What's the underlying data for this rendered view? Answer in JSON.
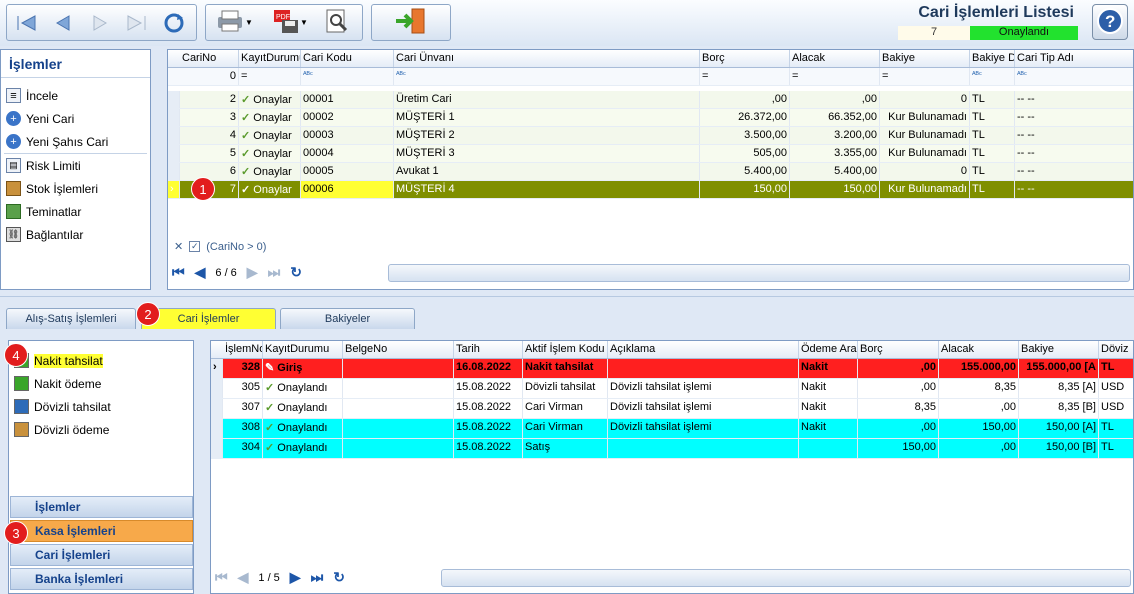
{
  "window": {
    "title": "Cari İşlemleri Listesi",
    "record_value": "7",
    "status": "Onaylandı",
    "status_color": "#22e22e"
  },
  "toolbar": {
    "icons": [
      "first-icon",
      "prev-icon",
      "next-icon",
      "last-icon",
      "refresh-icon",
      "print-icon",
      "pdf-save-icon",
      "search-doc-icon",
      "exit-icon",
      "help-icon"
    ]
  },
  "side_menu": {
    "title": "İşlemler",
    "items": [
      {
        "label": "İncele",
        "icon": "document-icon"
      },
      {
        "label": "Yeni Cari",
        "icon": "add-icon"
      },
      {
        "label": "Yeni Şahıs Cari",
        "icon": "add-icon"
      },
      {
        "label": "Risk Limiti",
        "icon": "chart-icon"
      },
      {
        "label": "Stok İşlemleri",
        "icon": "box-icon"
      },
      {
        "label": "Teminatlar",
        "icon": "money-icon"
      },
      {
        "label": "Bağlantılar",
        "icon": "link-icon"
      }
    ]
  },
  "top_grid": {
    "columns": [
      "CariNo",
      "KayıtDurumu",
      "Cari Kodu",
      "Cari Ünvanı",
      "Borç",
      "Alacak",
      "Bakiye",
      "Bakiye D",
      "Cari Tip Adı"
    ],
    "filter_row": {
      "cari_no": "0",
      "filter_symbol": "="
    },
    "rows": [
      {
        "no": "2",
        "status": "Onaylar",
        "code": "00001",
        "name": "Üretim Cari",
        "borc": ",00",
        "alacak": ",00",
        "bakiye": "0",
        "dov": "TL",
        "tip": "-- --"
      },
      {
        "no": "3",
        "status": "Onaylar",
        "code": "00002",
        "name": "MÜŞTERİ 1",
        "borc": "26.372,00",
        "alacak": "66.352,00",
        "bakiye": "Kur Bulunamadı",
        "dov": "TL",
        "tip": "-- --"
      },
      {
        "no": "4",
        "status": "Onaylar",
        "code": "00003",
        "name": "MÜŞTERİ 2",
        "borc": "3.500,00",
        "alacak": "3.200,00",
        "bakiye": "Kur Bulunamadı",
        "dov": "TL",
        "tip": "-- --"
      },
      {
        "no": "5",
        "status": "Onaylar",
        "code": "00004",
        "name": "MÜŞTERİ 3",
        "borc": "505,00",
        "alacak": "3.355,00",
        "bakiye": "Kur Bulunamadı",
        "dov": "TL",
        "tip": "-- --"
      },
      {
        "no": "6",
        "status": "Onaylar",
        "code": "00005",
        "name": "Avukat 1",
        "borc": "5.400,00",
        "alacak": "5.400,00",
        "bakiye": "0",
        "dov": "TL",
        "tip": "-- --"
      },
      {
        "no": "7",
        "status": "Onaylar",
        "code": "00006",
        "name": "MÜŞTERİ 4",
        "borc": "150,00",
        "alacak": "150,00",
        "bakiye": "Kur Bulunamadı",
        "dov": "TL",
        "tip": "-- --"
      }
    ],
    "filter_text": "(CariNo > 0)",
    "pager": "6 / 6"
  },
  "tabs": [
    "Alış-Satış İşlemleri",
    "Cari İşlemler",
    "Bakiyeler"
  ],
  "left_actions": [
    {
      "label": "Nakit tahsilat",
      "icon": "cash-in-icon"
    },
    {
      "label": "Nakit ödeme",
      "icon": "cash-out-icon"
    },
    {
      "label": "Dövizli tahsilat",
      "icon": "fx-in-icon"
    },
    {
      "label": "Dövizli ödeme",
      "icon": "fx-out-icon"
    }
  ],
  "left_sections": [
    "İşlemler",
    "Kasa İşlemleri",
    "Cari İşlemleri",
    "Banka İşlemleri"
  ],
  "bottom_grid": {
    "columns": [
      "İşlemNo",
      "KayıtDurumu",
      "BelgeNo",
      "Tarih",
      "Aktif İşlem Kodu",
      "Açıklama",
      "Ödeme Aracı",
      "Borç",
      "Alacak",
      "Bakiye",
      "Döviz"
    ],
    "rows": [
      {
        "no": "328",
        "status": "Giriş",
        "belge": "",
        "tarih": "16.08.2022",
        "kod": "Nakit tahsilat",
        "aciklama": "",
        "odeme": "Nakit",
        "borc": ",00",
        "alacak": "155.000,00",
        "bakiye": "155.000,00 [A",
        "doviz": "TL",
        "bg": "#ff1f1f",
        "bold": true
      },
      {
        "no": "305",
        "status": "Onaylandı",
        "belge": "",
        "tarih": "15.08.2022",
        "kod": "Dövizli tahsilat",
        "aciklama": "Dövizli tahsilat işlemi",
        "odeme": "Nakit",
        "borc": ",00",
        "alacak": "8,35",
        "bakiye": "8,35 [A]",
        "doviz": "USD",
        "bg": "#ffffff",
        "bold": false
      },
      {
        "no": "307",
        "status": "Onaylandı",
        "belge": "",
        "tarih": "15.08.2022",
        "kod": "Cari Virman",
        "aciklama": "Dövizli tahsilat işlemi",
        "odeme": "Nakit",
        "borc": "8,35",
        "alacak": ",00",
        "bakiye": "8,35 [B]",
        "doviz": "USD",
        "bg": "#ffffff",
        "bold": false
      },
      {
        "no": "308",
        "status": "Onaylandı",
        "belge": "",
        "tarih": "15.08.2022",
        "kod": "Cari Virman",
        "aciklama": "Dövizli tahsilat işlemi",
        "odeme": "Nakit",
        "borc": ",00",
        "alacak": "150,00",
        "bakiye": "150,00 [A]",
        "doviz": "TL",
        "bg": "#00ffff",
        "bold": false
      },
      {
        "no": "304",
        "status": "Onaylandı",
        "belge": "",
        "tarih": "15.08.2022",
        "kod": "Satış",
        "aciklama": "",
        "odeme": "",
        "borc": "150,00",
        "alacak": ",00",
        "bakiye": "150,00 [B]",
        "doviz": "TL",
        "bg": "#00ffff",
        "bold": false
      }
    ],
    "pager": "1 / 5"
  },
  "badges": [
    "1",
    "2",
    "3",
    "4"
  ],
  "colors": {
    "selected_row": "#7f8f00",
    "highlight": "#ffff33",
    "kasa_active": "#f7a94a"
  }
}
